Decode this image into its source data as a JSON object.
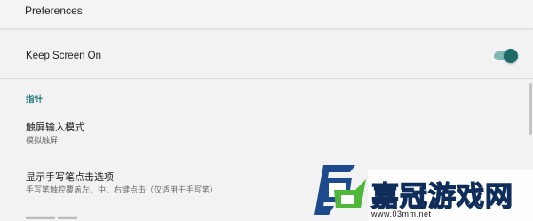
{
  "header": {
    "title": "Preferences"
  },
  "keep_screen": {
    "label": "Keep Screen On",
    "enabled": true
  },
  "section": {
    "label": "指针"
  },
  "items": [
    {
      "title": "触屏输入模式",
      "summary": "模拟触屏"
    },
    {
      "title": "显示手写笔点击选项",
      "summary": "手写笔触控覆盖左、中、右键点击（仅适用于手写笔）"
    }
  ],
  "watermark": {
    "brand": "嘉冠游戏网",
    "url": "www.03mm.net"
  },
  "colors": {
    "accent": "#1e7a78",
    "toggle_thumb": "#1b6b68",
    "toggle_track": "#7fb8b4",
    "background": "#f2f2f2"
  }
}
